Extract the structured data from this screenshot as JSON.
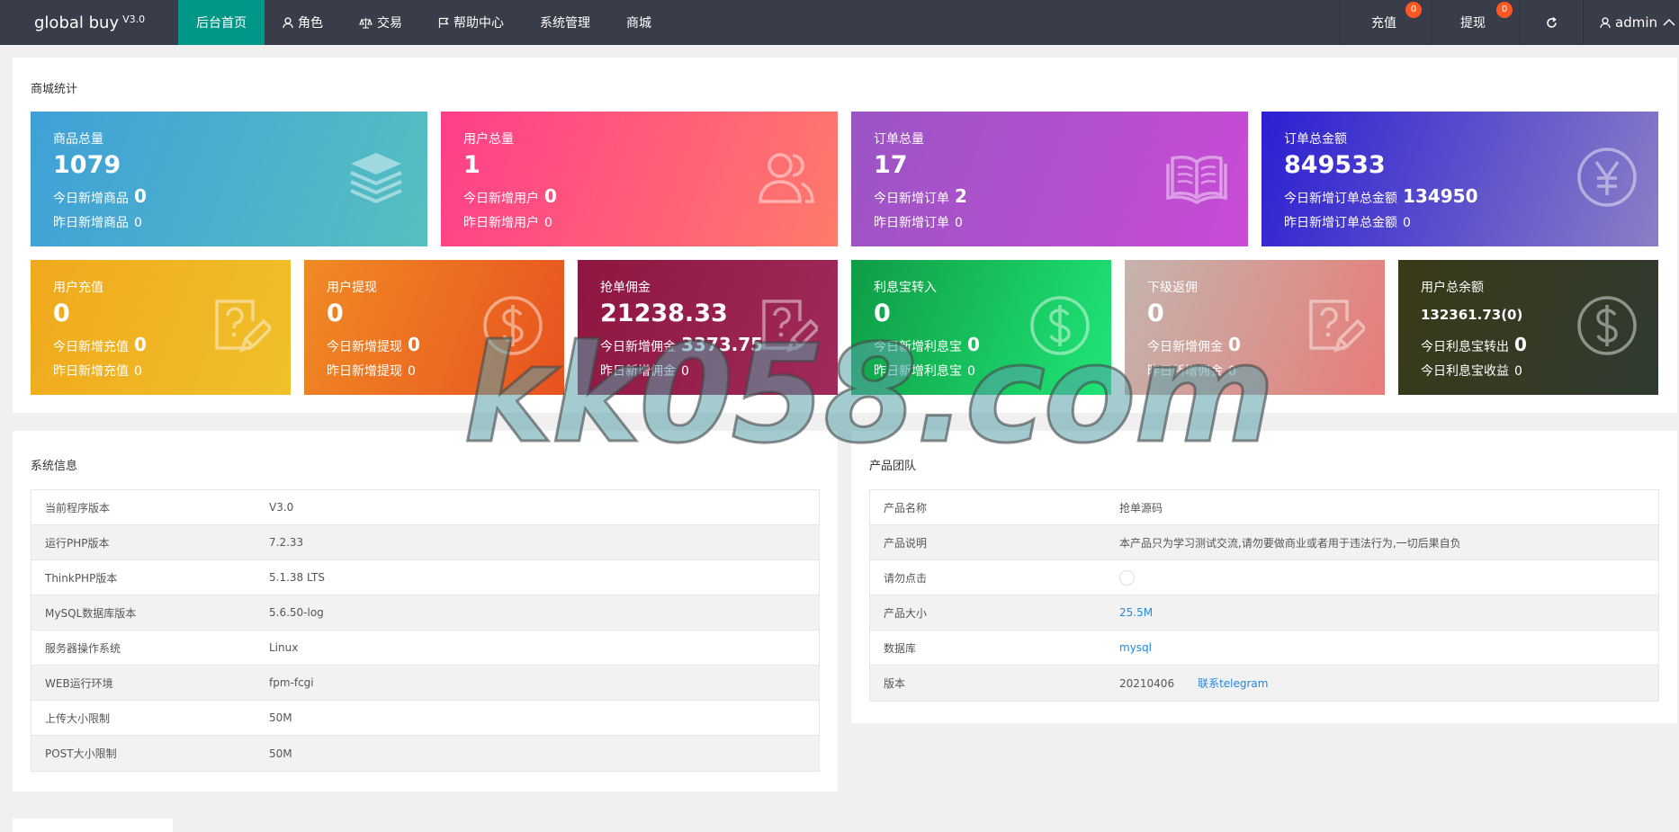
{
  "app": {
    "name": "global buy",
    "version": "V3.0"
  },
  "nav": {
    "items": [
      {
        "label": "后台首页",
        "icon": "",
        "active": true
      },
      {
        "label": "角色",
        "icon": "user-icon"
      },
      {
        "label": "交易",
        "icon": "scale-icon"
      },
      {
        "label": "帮助中心",
        "icon": "flag-icon"
      },
      {
        "label": "系统管理",
        "icon": ""
      },
      {
        "label": "商城",
        "icon": ""
      }
    ],
    "right": {
      "recharge": "充值",
      "recharge_badge": "0",
      "withdraw": "提现",
      "withdraw_badge": "0",
      "refresh_icon": "refresh-icon",
      "user": "admin"
    }
  },
  "stats": {
    "title": "商城统计",
    "row1": [
      {
        "title": "商品总量",
        "value": "1079",
        "today_label": "今日新增商品",
        "today_value": "0",
        "yest_label": "昨日新增商品",
        "yest_value": "0",
        "icon": "layers-icon",
        "grad": [
          "#3fa0d8",
          "#55bfc0"
        ]
      },
      {
        "title": "用户总量",
        "value": "1",
        "today_label": "今日新增用户",
        "today_value": "0",
        "yest_label": "昨日新增用户",
        "yest_value": "0",
        "icon": "users-icon",
        "grad": [
          "#ff3e8a",
          "#ff7a6a"
        ]
      },
      {
        "title": "订单总量",
        "value": "17",
        "today_label": "今日新增订单",
        "today_value": "2",
        "yest_label": "昨日新增订单",
        "yest_value": "0",
        "icon": "book-icon",
        "grad": [
          "#9a55c4",
          "#c94bd6"
        ]
      },
      {
        "title": "订单总金额",
        "value": "849533",
        "today_label": "今日新增订单总金额",
        "today_value": "134950",
        "yest_label": "昨日新增订单总金额",
        "yest_value": "0",
        "icon": "yen-icon",
        "grad": [
          "#2b1fd2",
          "#8a7fc6"
        ]
      }
    ],
    "row2": [
      {
        "title": "用户充值",
        "value": "0",
        "today_label": "今日新增充值",
        "today_value": "0",
        "yest_label": "昨日新增充值",
        "yest_value": "0",
        "icon": "question-doc-icon",
        "grad": [
          "#f0a91e",
          "#f0c02a"
        ]
      },
      {
        "title": "用户提现",
        "value": "0",
        "today_label": "今日新增提现",
        "today_value": "0",
        "yest_label": "昨日新增提现",
        "yest_value": "0",
        "icon": "dollar-icon",
        "grad": [
          "#f08a24",
          "#e8521f"
        ]
      },
      {
        "title": "抢单佣金",
        "value": "21238.33",
        "today_label": "今日新增佣金",
        "today_value": "3373.75",
        "yest_label": "昨日新增佣金",
        "yest_value": "0",
        "icon": "question-doc-icon",
        "grad": [
          "#8e1640",
          "#a02a5a"
        ]
      },
      {
        "title": "利息宝转入",
        "value": "0",
        "today_label": "今日新增利息宝",
        "today_value": "0",
        "yest_label": "昨日新增利息宝",
        "yest_value": "0",
        "icon": "dollar-icon",
        "grad": [
          "#0f9c45",
          "#20e676"
        ]
      },
      {
        "title": "下级返佣",
        "value": "0",
        "today_label": "今日新增佣金",
        "today_value": "0",
        "yest_label": "昨日新增佣金",
        "yest_value": "0",
        "icon": "question-doc-icon",
        "grad": [
          "#c4b4ad",
          "#e87c78"
        ]
      },
      {
        "title": "用户总余额",
        "value": "132361.73(0)",
        "today_label": "今日利息宝转出",
        "today_value": "0",
        "yest_label": "今日利息宝收益",
        "yest_value": "0",
        "icon": "dollar-icon",
        "grad": [
          "#3a3a18",
          "#2f3a30"
        ]
      }
    ]
  },
  "sysinfo": {
    "title": "系统信息",
    "rows": [
      {
        "k": "当前程序版本",
        "v": "V3.0"
      },
      {
        "k": "运行PHP版本",
        "v": "7.2.33"
      },
      {
        "k": "ThinkPHP版本",
        "v": "5.1.38 LTS"
      },
      {
        "k": "MySQL数据库版本",
        "v": "5.6.50-log"
      },
      {
        "k": "服务器操作系统",
        "v": "Linux"
      },
      {
        "k": "WEB运行环境",
        "v": "fpm-fcgi"
      },
      {
        "k": "上传大小限制",
        "v": "50M"
      },
      {
        "k": "POST大小限制",
        "v": "50M"
      }
    ]
  },
  "team": {
    "title": "产品团队",
    "rows": [
      {
        "k": "产品名称",
        "v": "抢单源码"
      },
      {
        "k": "产品说明",
        "v": "本产品只为学习测试交流,请勿要做商业或者用于违法行为,一切后果自负"
      },
      {
        "k": "请勿点击",
        "v": ""
      },
      {
        "k": "产品大小",
        "v": "25.5M"
      },
      {
        "k": "数据库",
        "v": "mysql"
      },
      {
        "k": "版本",
        "v": "20210406",
        "extra": "联系telegram"
      }
    ]
  },
  "watermark": "kk058.com"
}
